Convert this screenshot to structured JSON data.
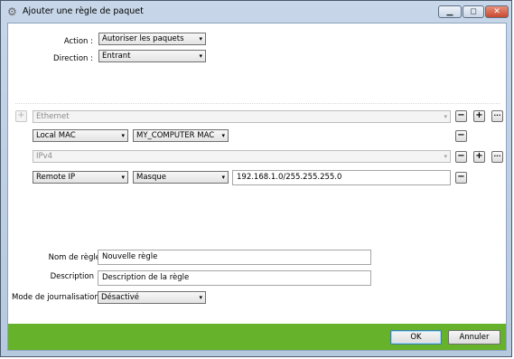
{
  "window": {
    "title": "Ajouter une règle de paquet",
    "app_icon": "gear-icon",
    "controls": {
      "minimize": "▁",
      "maximize": "◻",
      "close": "✕"
    }
  },
  "top": {
    "action_label": "Action :",
    "action_value": "Autoriser les paquets",
    "direction_label": "Direction :",
    "direction_value": "Entrant"
  },
  "filters": {
    "ethernet": {
      "value": "Ethernet"
    },
    "mac": {
      "field": "Local MAC",
      "value": "MY_COMPUTER MAC"
    },
    "ipv4": {
      "value": "IPv4"
    },
    "ip": {
      "field": "Remote IP",
      "mode": "Masque",
      "value": "192.168.1.0/255.255.255.0"
    }
  },
  "rule": {
    "name_label": "Nom de règle",
    "name_value": "Nouvelle règle",
    "desc_label": "Description",
    "desc_value": "Description de la règle",
    "log_label": "Mode de journalisation",
    "log_value": "Désactivé"
  },
  "footer": {
    "ok": "OK",
    "cancel": "Annuler",
    "color": "#66b22a"
  },
  "glyphs": {
    "arrow": "▾",
    "plus": "+",
    "minus": "−",
    "more": "···"
  }
}
